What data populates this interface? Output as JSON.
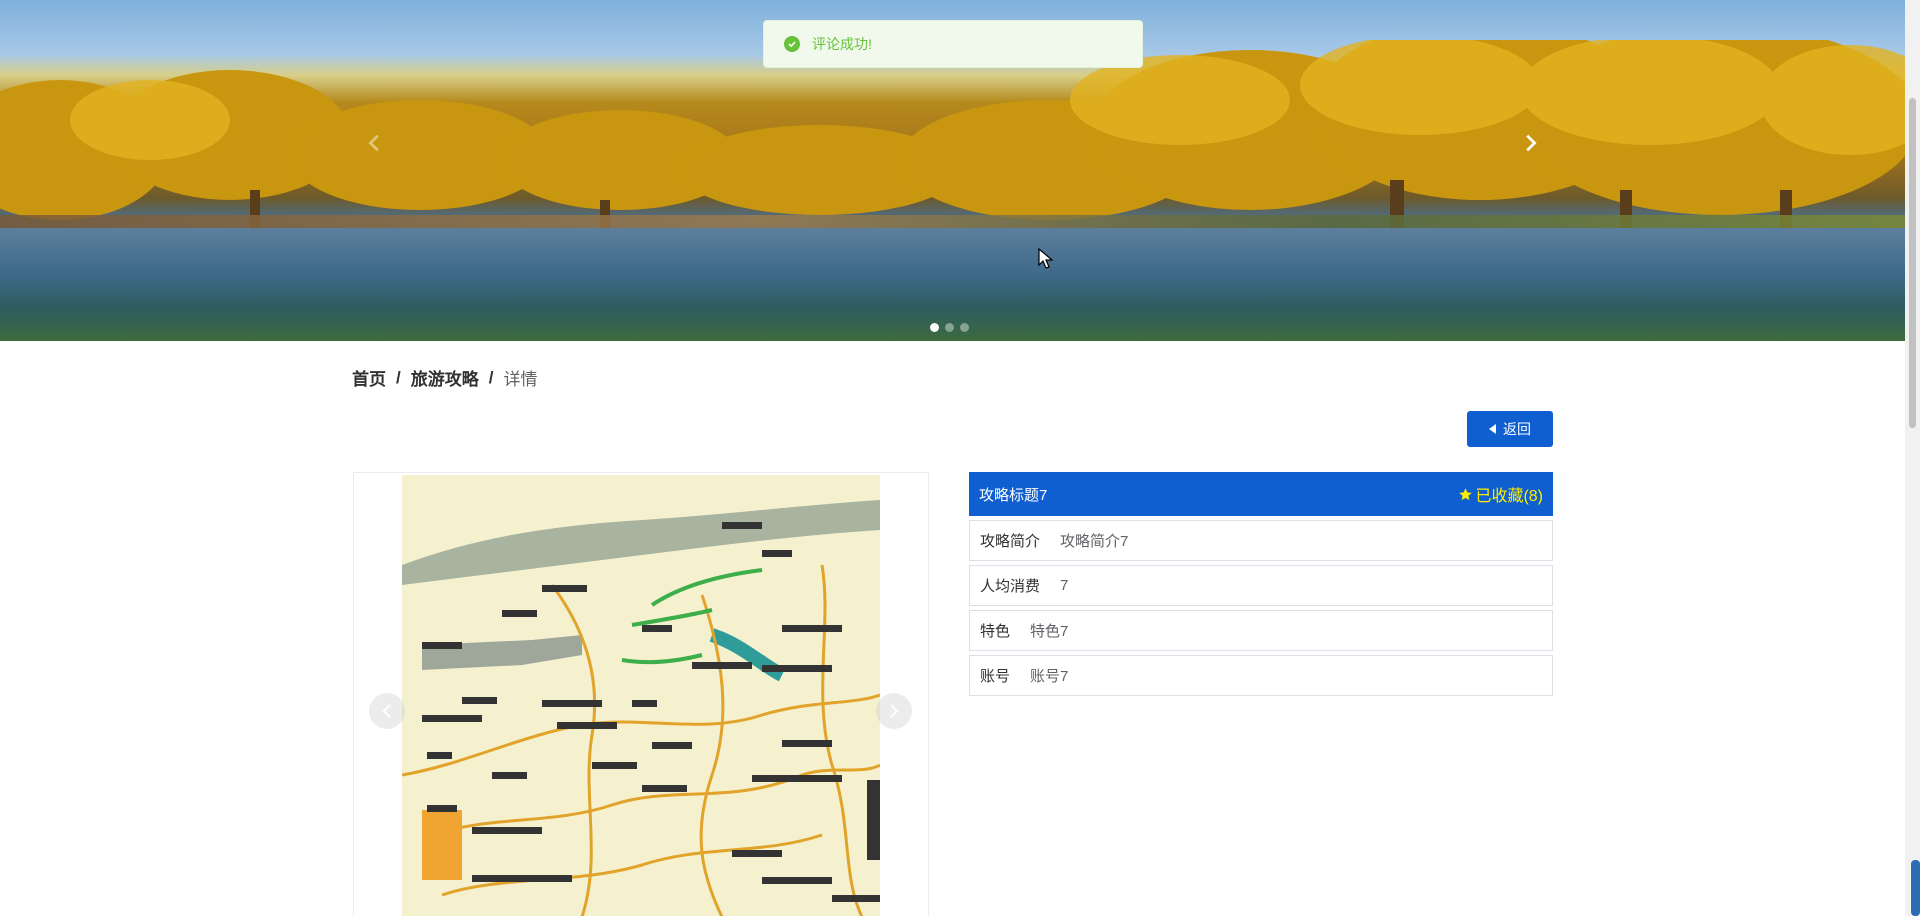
{
  "banner": {
    "slide_count": 3,
    "active_slide": 0,
    "prev_icon": "chevron-left-icon",
    "next_icon": "chevron-right-icon"
  },
  "toast": {
    "icon": "check-circle-icon",
    "message": "评论成功!",
    "color": "#67c23a"
  },
  "breadcrumb": {
    "home": "首页",
    "section": "旅游攻略",
    "current": "详情",
    "separator": "/"
  },
  "back_button": {
    "icon": "caret-left-icon",
    "label": "返回"
  },
  "image_carousel": {
    "image": "tour-route-map",
    "prev_icon": "chevron-left-icon",
    "next_icon": "chevron-right-icon"
  },
  "detail": {
    "title": "攻略标题7",
    "favorite": {
      "icon": "star-icon",
      "label": "已收藏(8)"
    },
    "rows": [
      {
        "key": "攻略简介",
        "value": "攻略简介7"
      },
      {
        "key": "人均消费",
        "value": "7"
      },
      {
        "key": "特色",
        "value": "特色7"
      },
      {
        "key": "账号",
        "value": "账号7"
      }
    ]
  },
  "colors": {
    "primary": "#0f5fd1",
    "favorite": "#ffee00",
    "success": "#67c23a"
  }
}
